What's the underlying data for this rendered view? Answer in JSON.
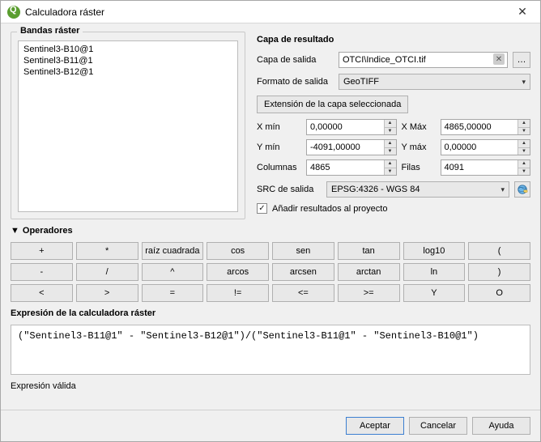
{
  "window": {
    "title": "Calculadora ráster"
  },
  "bands": {
    "title": "Bandas ráster",
    "items": [
      "Sentinel3-B10@1",
      "Sentinel3-B11@1",
      "Sentinel3-B12@1"
    ]
  },
  "result": {
    "title": "Capa de resultado",
    "output_layer_label": "Capa de salida",
    "output_layer_value": "OTCI\\Indice_OTCI.tif",
    "output_format_label": "Formato de salida",
    "output_format_value": "GeoTIFF",
    "extent_button": "Extensión de la capa seleccionada",
    "xmin_label": "X mín",
    "xmin_value": "0,00000",
    "xmax_label": "X Máx",
    "xmax_value": "4865,00000",
    "ymin_label": "Y mín",
    "ymin_value": "-4091,00000",
    "ymax_label": "Y máx",
    "ymax_value": "0,00000",
    "cols_label": "Columnas",
    "cols_value": "4865",
    "rows_label": "Filas",
    "rows_value": "4091",
    "crs_label": "SRC de salida",
    "crs_value": "EPSG:4326 - WGS 84",
    "add_to_project_label": "Añadir resultados al proyecto",
    "add_to_project_checked": true
  },
  "operators": {
    "title": "Operadores",
    "buttons": [
      "+",
      "*",
      "raíz cuadrada",
      "cos",
      "sen",
      "tan",
      "log10",
      "(",
      "-",
      "/",
      "^",
      "arcos",
      "arcsen",
      "arctan",
      "ln",
      ")",
      "<",
      ">",
      "=",
      "!=",
      "<=",
      ">=",
      "Y",
      "O"
    ]
  },
  "expression": {
    "title": "Expresión de la calculadora ráster",
    "value": "(\"Sentinel3-B11@1\" - \"Sentinel3-B12@1\")/(\"Sentinel3-B11@1\" - \"Sentinel3-B10@1\")"
  },
  "status": "Expresión válida",
  "buttons": {
    "ok": "Aceptar",
    "cancel": "Cancelar",
    "help": "Ayuda"
  }
}
